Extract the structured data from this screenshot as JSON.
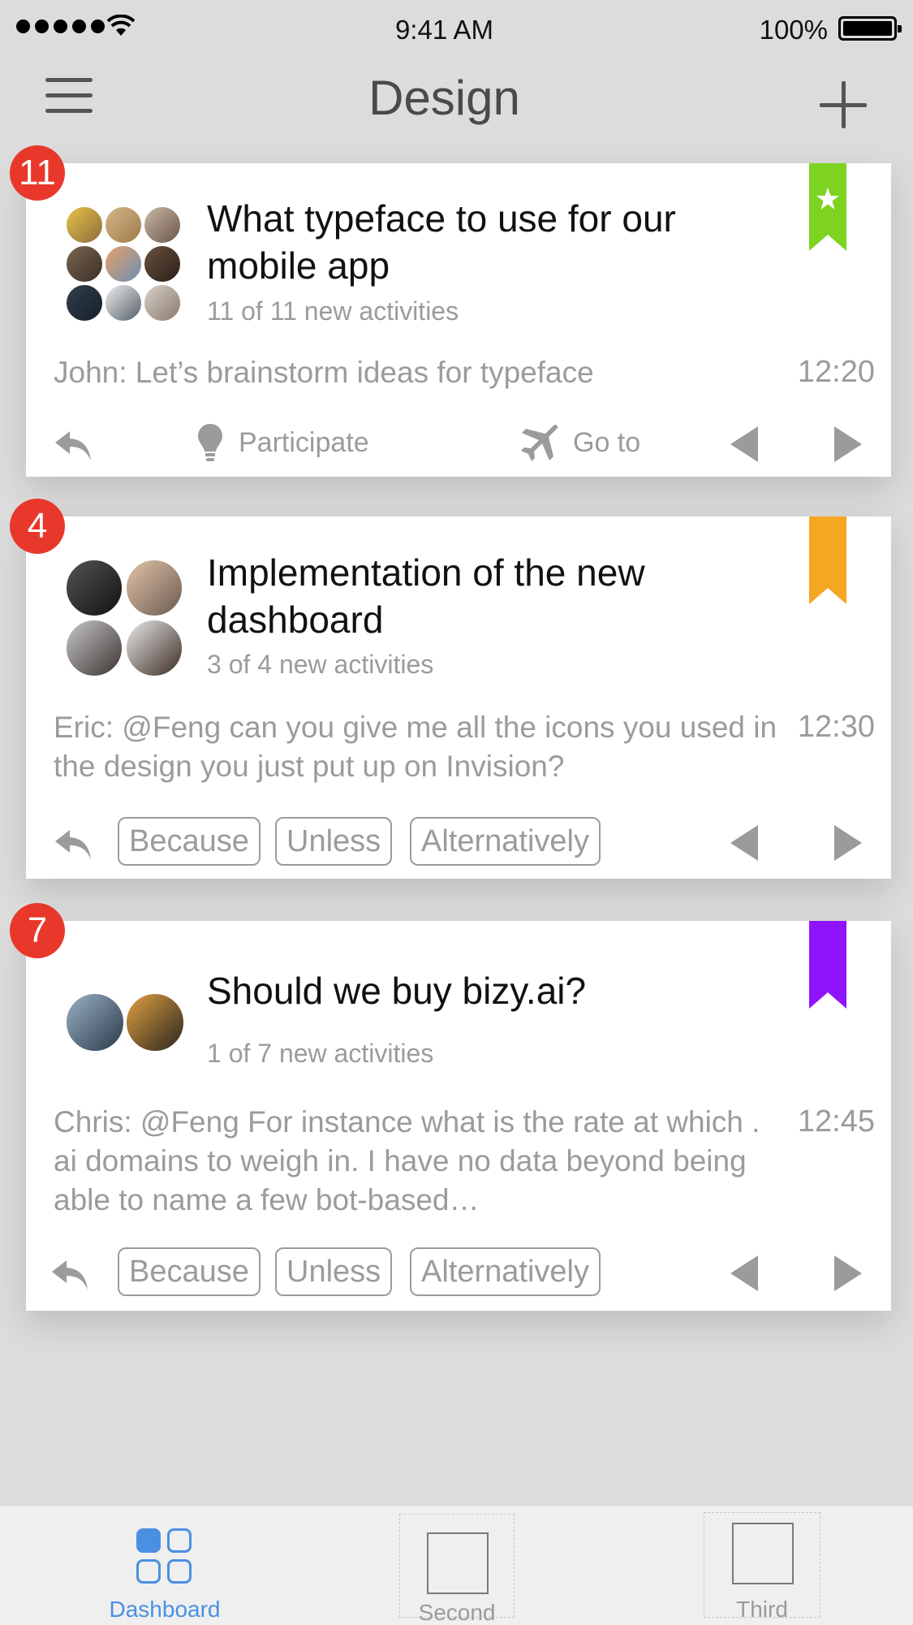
{
  "status_bar": {
    "time": "9:41 AM",
    "battery": "100%"
  },
  "nav": {
    "title": "Design"
  },
  "cards": [
    {
      "badge": "11",
      "bookmark_color": "#7ed321",
      "title": "What typeface to use for our mobile app",
      "subtitle": "11 of 11 new activities",
      "preview": "John: Let’s brainstorm ideas for typeface",
      "time": "12:20",
      "actions": {
        "participate": "Participate",
        "goto": "Go to"
      }
    },
    {
      "badge": "4",
      "bookmark_color": "#f5a623",
      "title": "Implementation of the new dashboard",
      "subtitle": "3 of 4 new activities",
      "preview": "Eric: @Feng can you give me all the icons you used in the design you just put up on Invision?",
      "time": "12:30",
      "chips": [
        "Because",
        "Unless",
        "Alternatively"
      ]
    },
    {
      "badge": "7",
      "bookmark_color": "#9013fe",
      "title": "Should we buy bizy.ai?",
      "subtitle": "1 of 7 new activities",
      "preview": "Chris: @Feng For instance what is the rate at which . ai domains to weigh in. I have no data beyond being able to name a few bot-based…",
      "time": "12:45",
      "chips": [
        "Because",
        "Unless",
        "Alternatively"
      ]
    }
  ],
  "tabs": [
    {
      "label": "Dashboard",
      "active": true,
      "icon": "dashboard-grid-icon"
    },
    {
      "label": "Second",
      "active": false,
      "icon": "placeholder-icon"
    },
    {
      "label": "Third",
      "active": false,
      "icon": "placeholder-icon"
    }
  ],
  "colors": {
    "accent": "#4a90e2",
    "badge": "#e8382b"
  }
}
